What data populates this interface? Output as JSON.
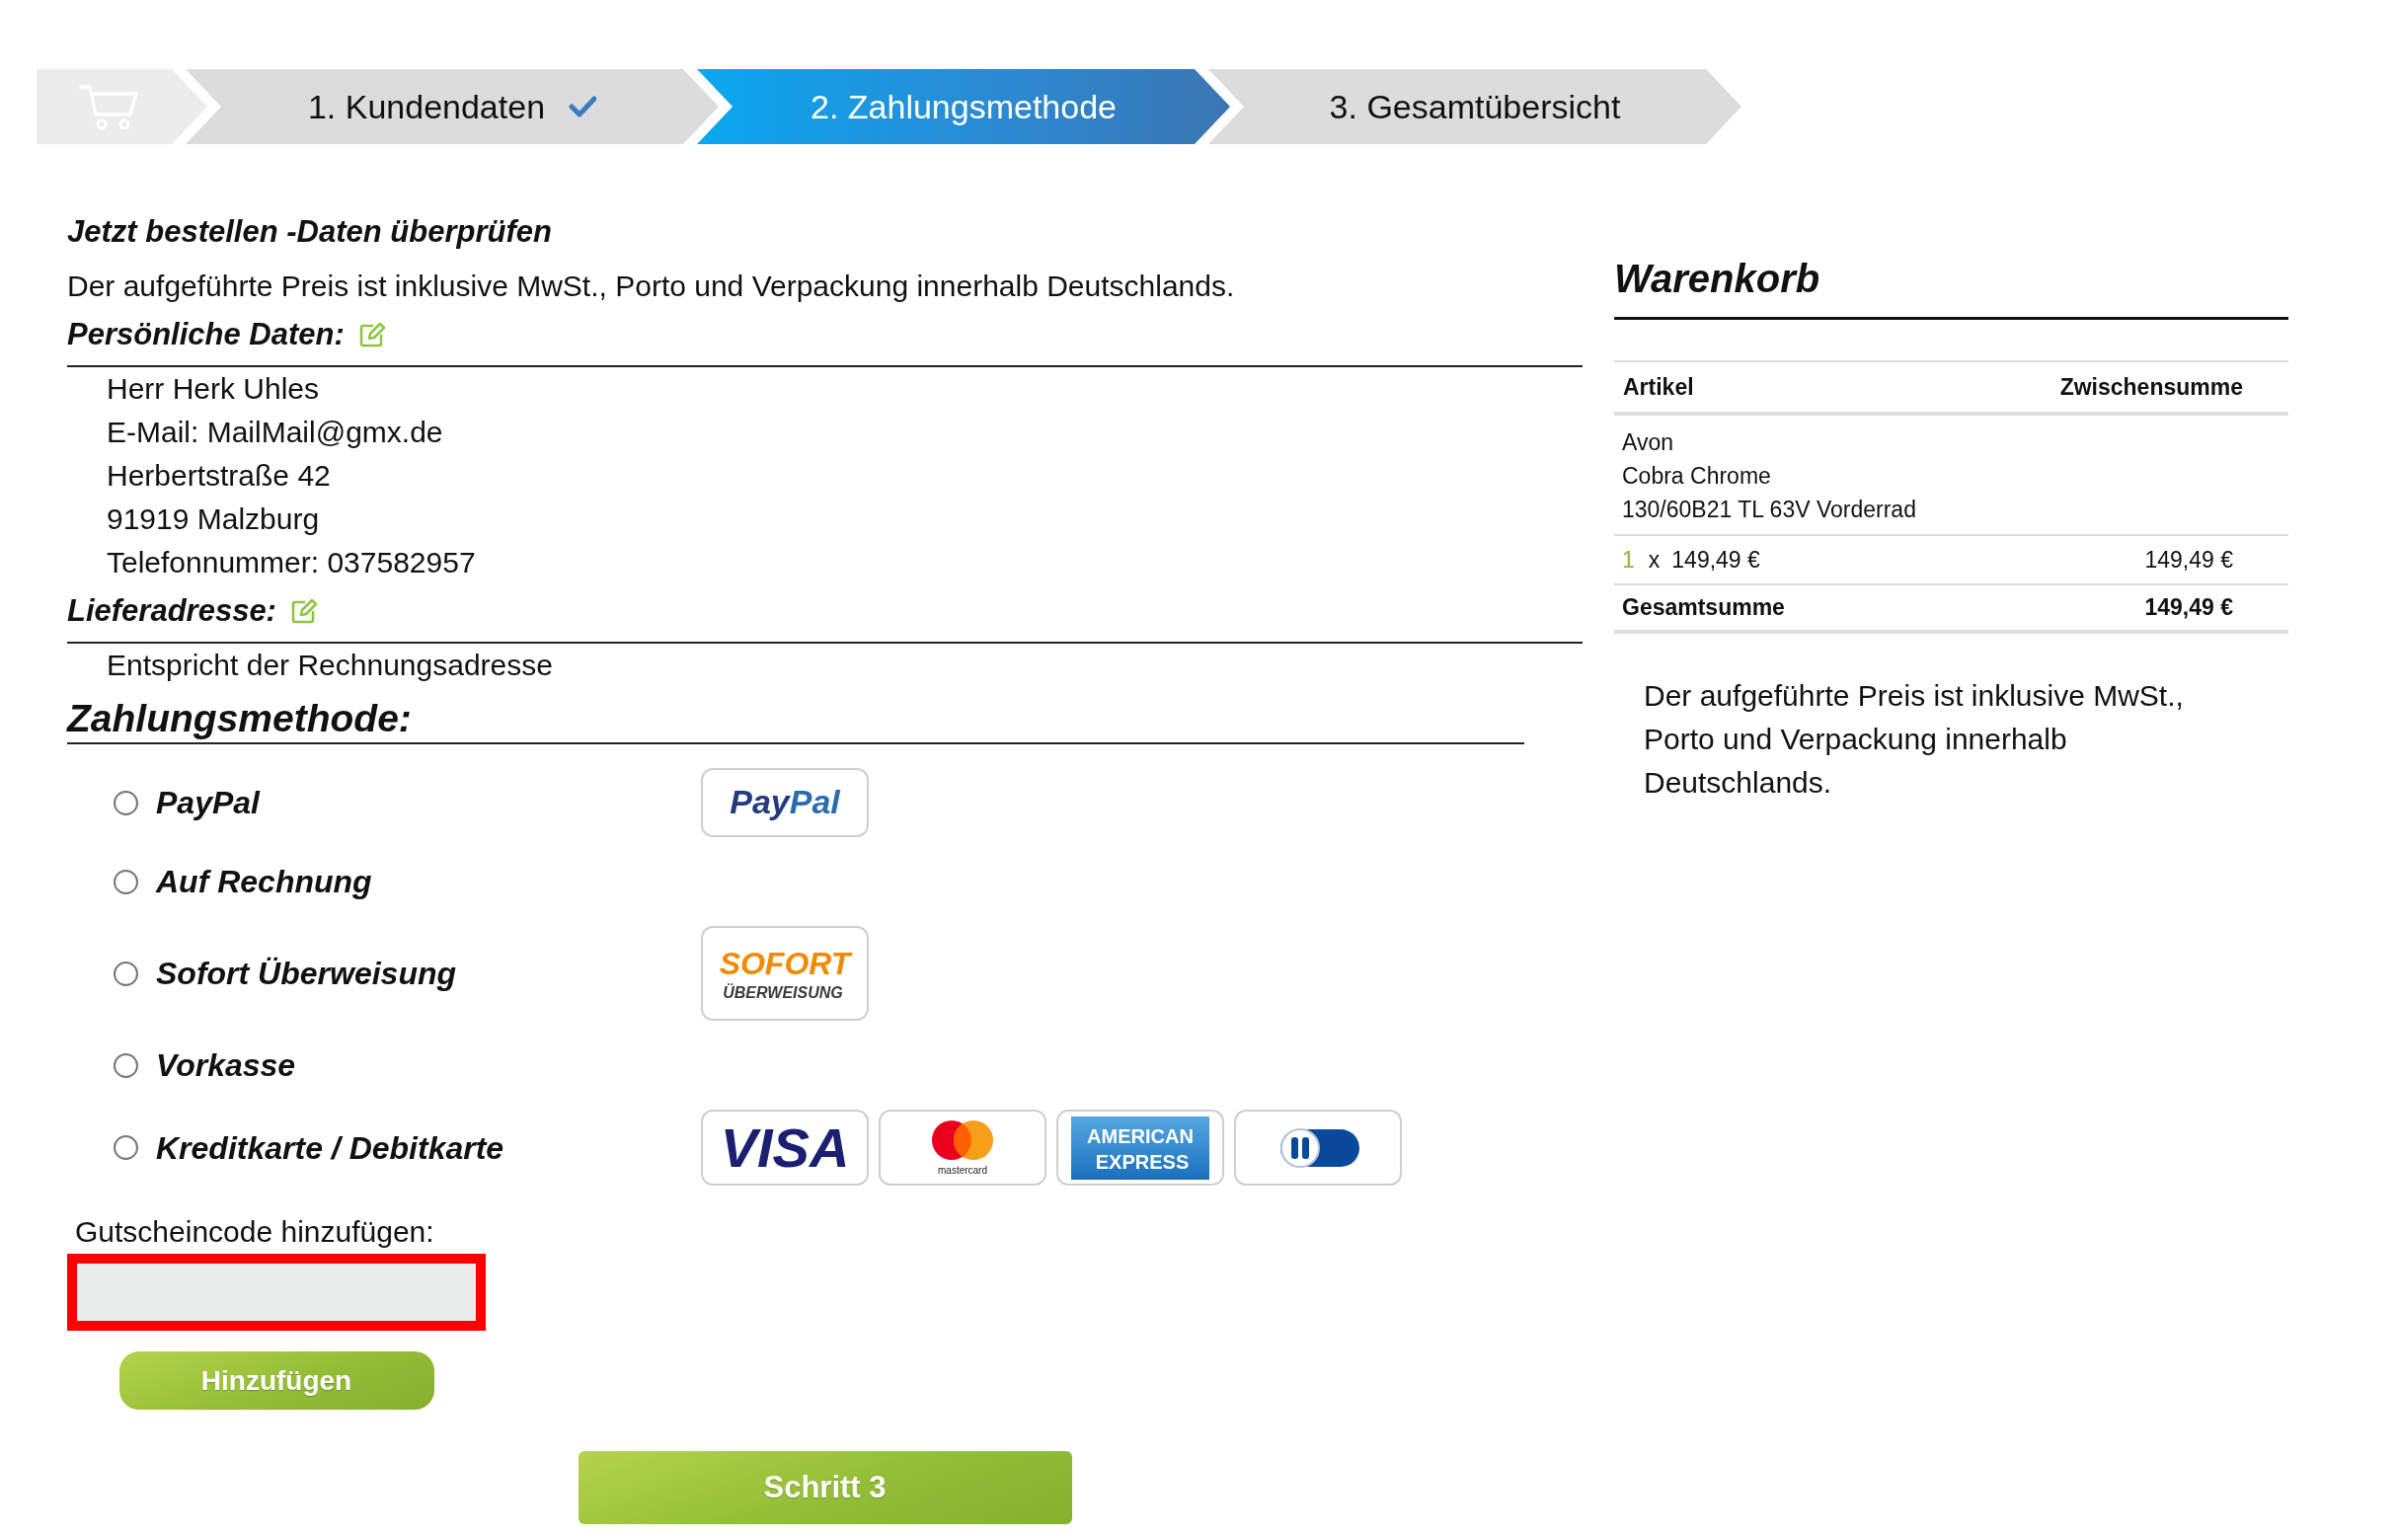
{
  "stepper": {
    "steps": [
      {
        "label": "1. Kundendaten",
        "completed": true,
        "selected": false
      },
      {
        "label": "2. Zahlungsmethode",
        "completed": false,
        "selected": true
      },
      {
        "label": "3. Gesamtübersicht",
        "completed": false,
        "selected": false
      }
    ]
  },
  "review": {
    "title": "Jetzt bestellen -Daten überprüfen",
    "note": "Der aufgeführte Preis ist inklusive MwSt., Porto und Verpackung innerhalb Deutschlands.",
    "sections": [
      {
        "heading": "Persönliche Daten:",
        "editable": true,
        "lines": [
          "Herr Herk Uhles",
          "E-Mail: MailMail@gmx.de",
          "Herbertstraße 42",
          "91919 Malzburg",
          "Telefonnummer: 037582957"
        ]
      },
      {
        "heading": "Lieferadresse:",
        "editable": true,
        "lines": [
          "Entspricht der Rechnungsadresse"
        ]
      }
    ]
  },
  "payment": {
    "heading": "Zahlungsmethode:",
    "methods": [
      {
        "label": "PayPal",
        "selected": false,
        "logos": [
          {
            "kind": "paypal",
            "text": "PayPal"
          }
        ]
      },
      {
        "label": "Auf Rechnung",
        "selected": false
      },
      {
        "label": "Sofort Überweisung",
        "selected": false,
        "logos": [
          {
            "kind": "sofort",
            "text": "SOFORT",
            "subtext": "ÜBERWEISUNG"
          }
        ]
      },
      {
        "label": "Vorkasse",
        "selected": false
      },
      {
        "label": "Kreditkarte / Debitkarte",
        "selected": false,
        "logos": [
          {
            "kind": "visa",
            "text": "VISA"
          },
          {
            "kind": "mastercard",
            "text": "mastercard"
          },
          {
            "kind": "amex",
            "text": "AMERICAN",
            "subtext": "EXPRESS"
          },
          {
            "kind": "diners"
          }
        ]
      }
    ]
  },
  "voucher": {
    "label": "Gutscheincode hinzufügen:",
    "highlighted": true,
    "button": "Hinzufügen"
  },
  "next_button": "Schritt 3",
  "cart": {
    "title": "Warenkorb",
    "columns": [
      "Artikel",
      "Zwischensumme"
    ],
    "items": [
      {
        "name_lines": [
          "Avon",
          "Cobra Chrome",
          "130/60B21 TL 63V Vorderrad"
        ],
        "quantity": "1",
        "times": "x",
        "unit_price": "149,49 €",
        "subtotal": "149,49 €"
      }
    ],
    "total": {
      "label": "Gesamtsumme",
      "value": "149,49 €"
    },
    "note": "Der aufgeführte Preis ist inklusive MwSt., Porto und Verpackung innerhalb Deutschlands."
  }
}
